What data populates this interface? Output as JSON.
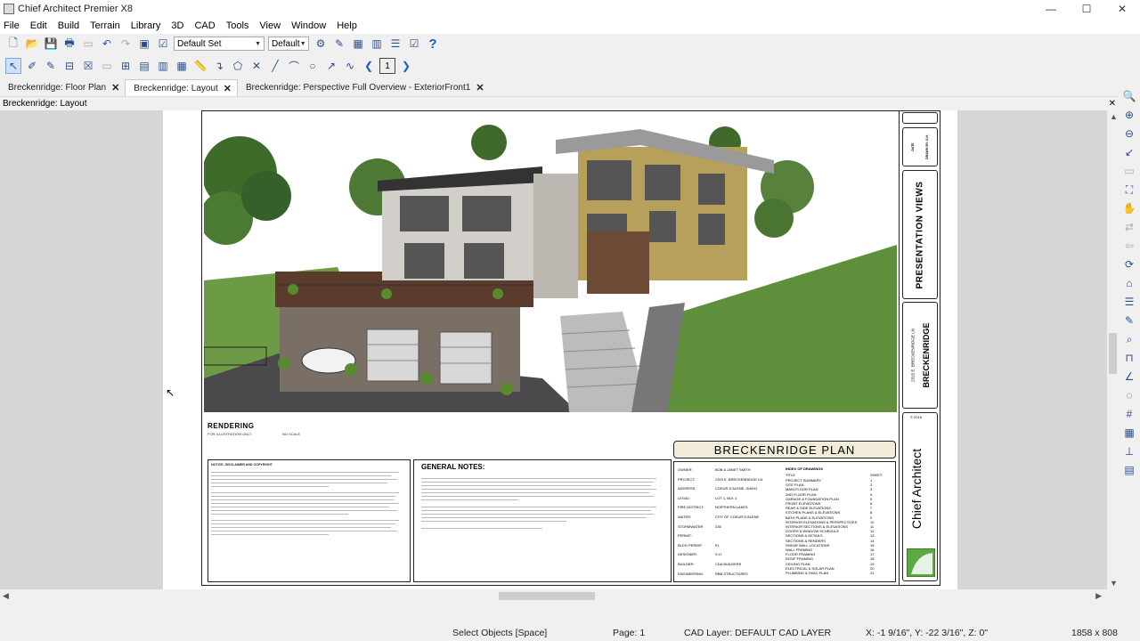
{
  "app": {
    "title": "Chief Architect Premier X8"
  },
  "window_controls": {
    "minimize": "—",
    "maximize": "☐",
    "close": "✕"
  },
  "menu": [
    "File",
    "Edit",
    "Build",
    "Terrain",
    "Library",
    "3D",
    "CAD",
    "Tools",
    "View",
    "Window",
    "Help"
  ],
  "toolbar": {
    "layer_set": "Default Set",
    "text_style": "Default",
    "help_glyph": "?"
  },
  "edit_toolbar": {
    "page_number": "1"
  },
  "tabs": [
    {
      "label": "Breckenridge: Floor Plan",
      "active": false
    },
    {
      "label": "Breckenridge: Layout",
      "active": true
    },
    {
      "label": "Breckenridge: Perspective Full Overview - ExteriorFront1",
      "active": false
    }
  ],
  "tab_close": "✕",
  "doc_title": "Breckenridge: Layout",
  "sheet": {
    "caption": "RENDERING",
    "caption_sub": "FOR ILLUSTRATION ONLY",
    "caption_sub2": "NO SCALE",
    "notes_heading": "NOTICE, DISCLAIMER AND COPYRIGHT",
    "general_notes_title": "GENERAL NOTES:",
    "plan_name": "BRECKENRIDGE PLAN",
    "presentation_views": "PRESENTATION VIEWS",
    "street": "2315 E. BRECKENRIDGE LN",
    "street_name": "BRECKENRIDGE",
    "brand": "Chief Architect",
    "copyright": "© 2016",
    "date_label": "DATE",
    "drawn_label": "DRAWN BY: S.H.",
    "project_rows": [
      {
        "k": "OWNER:",
        "v": "BOB & JANET SMITH"
      },
      {
        "k": "PROJECT:",
        "v": "2315 E. BRECKENRIDGE LN"
      },
      {
        "k": "ADDRESS:",
        "v": "COEUR D'ALENE, IDAHO"
      },
      {
        "k": "LEGAL:",
        "v": "LOT 1, BLK 1"
      },
      {
        "k": "FIRE DISTRICT:",
        "v": "NORTHERN LAKES"
      },
      {
        "k": "WATER:",
        "v": "CITY OF COEUR D'ALENE"
      },
      {
        "k": "STORMWATER PERMIT:",
        "v": "235"
      },
      {
        "k": "BLDG PERMIT:",
        "v": "91"
      },
      {
        "k": "DESIGNER:",
        "v": "S.H."
      },
      {
        "k": "BUILDER:",
        "v": "CDA BUILDERS"
      },
      {
        "k": "ENGINEERING:",
        "v": "RBB STRUCTURES"
      }
    ],
    "index_title": "INDEX OF DRAWINGS",
    "index_headers": [
      "TITLE",
      "SHEET"
    ],
    "index": [
      {
        "t": "PROJECT SUMMARY",
        "n": "1"
      },
      {
        "t": "SITE PLAN",
        "n": "2"
      },
      {
        "t": "MAIN FLOOR PLAN",
        "n": "3"
      },
      {
        "t": "2ND FLOOR PLAN",
        "n": "4"
      },
      {
        "t": "GARAGE & FOUNDATION PLAN",
        "n": "5"
      },
      {
        "t": "FRONT ELEVATIONS",
        "n": "6"
      },
      {
        "t": "REAR & SIDE ELEVATIONS",
        "n": "7"
      },
      {
        "t": "KITCHEN PLANS & ELEVATIONS",
        "n": "8"
      },
      {
        "t": "BATH PLANS & ELEVATIONS",
        "n": "9"
      },
      {
        "t": "INTERIOR ELEVATIONS & PERSPECTIVES",
        "n": "10"
      },
      {
        "t": "INTERIOR SECTIONS & ELEVATIONS",
        "n": "11"
      },
      {
        "t": "DOORS & WINDOW SCHEDULE",
        "n": "12"
      },
      {
        "t": "SECTIONS & DETAILS",
        "n": "13"
      },
      {
        "t": "SECTIONS & RENDERS",
        "n": "14"
      },
      {
        "t": "SHEAR WALL LOCATIONS",
        "n": "15"
      },
      {
        "t": "WALL FRAMING",
        "n": "16"
      },
      {
        "t": "FLOOR FRAMING",
        "n": "17"
      },
      {
        "t": "ROOF FRAMING",
        "n": "18"
      },
      {
        "t": "CEILING PLAN",
        "n": "19"
      },
      {
        "t": "ELECTRICAL & SOLAR PLAN",
        "n": "20"
      },
      {
        "t": "PLUMBING & HVAC PLAN",
        "n": "21"
      }
    ]
  },
  "status": {
    "mode": "Select Objects [Space]",
    "page": "Page: 1",
    "cad_layer": "CAD Layer:  DEFAULT CAD LAYER",
    "coords": "X: -1 9/16\", Y: -22 3/16\", Z: 0\"",
    "size": "1858 x 808"
  }
}
